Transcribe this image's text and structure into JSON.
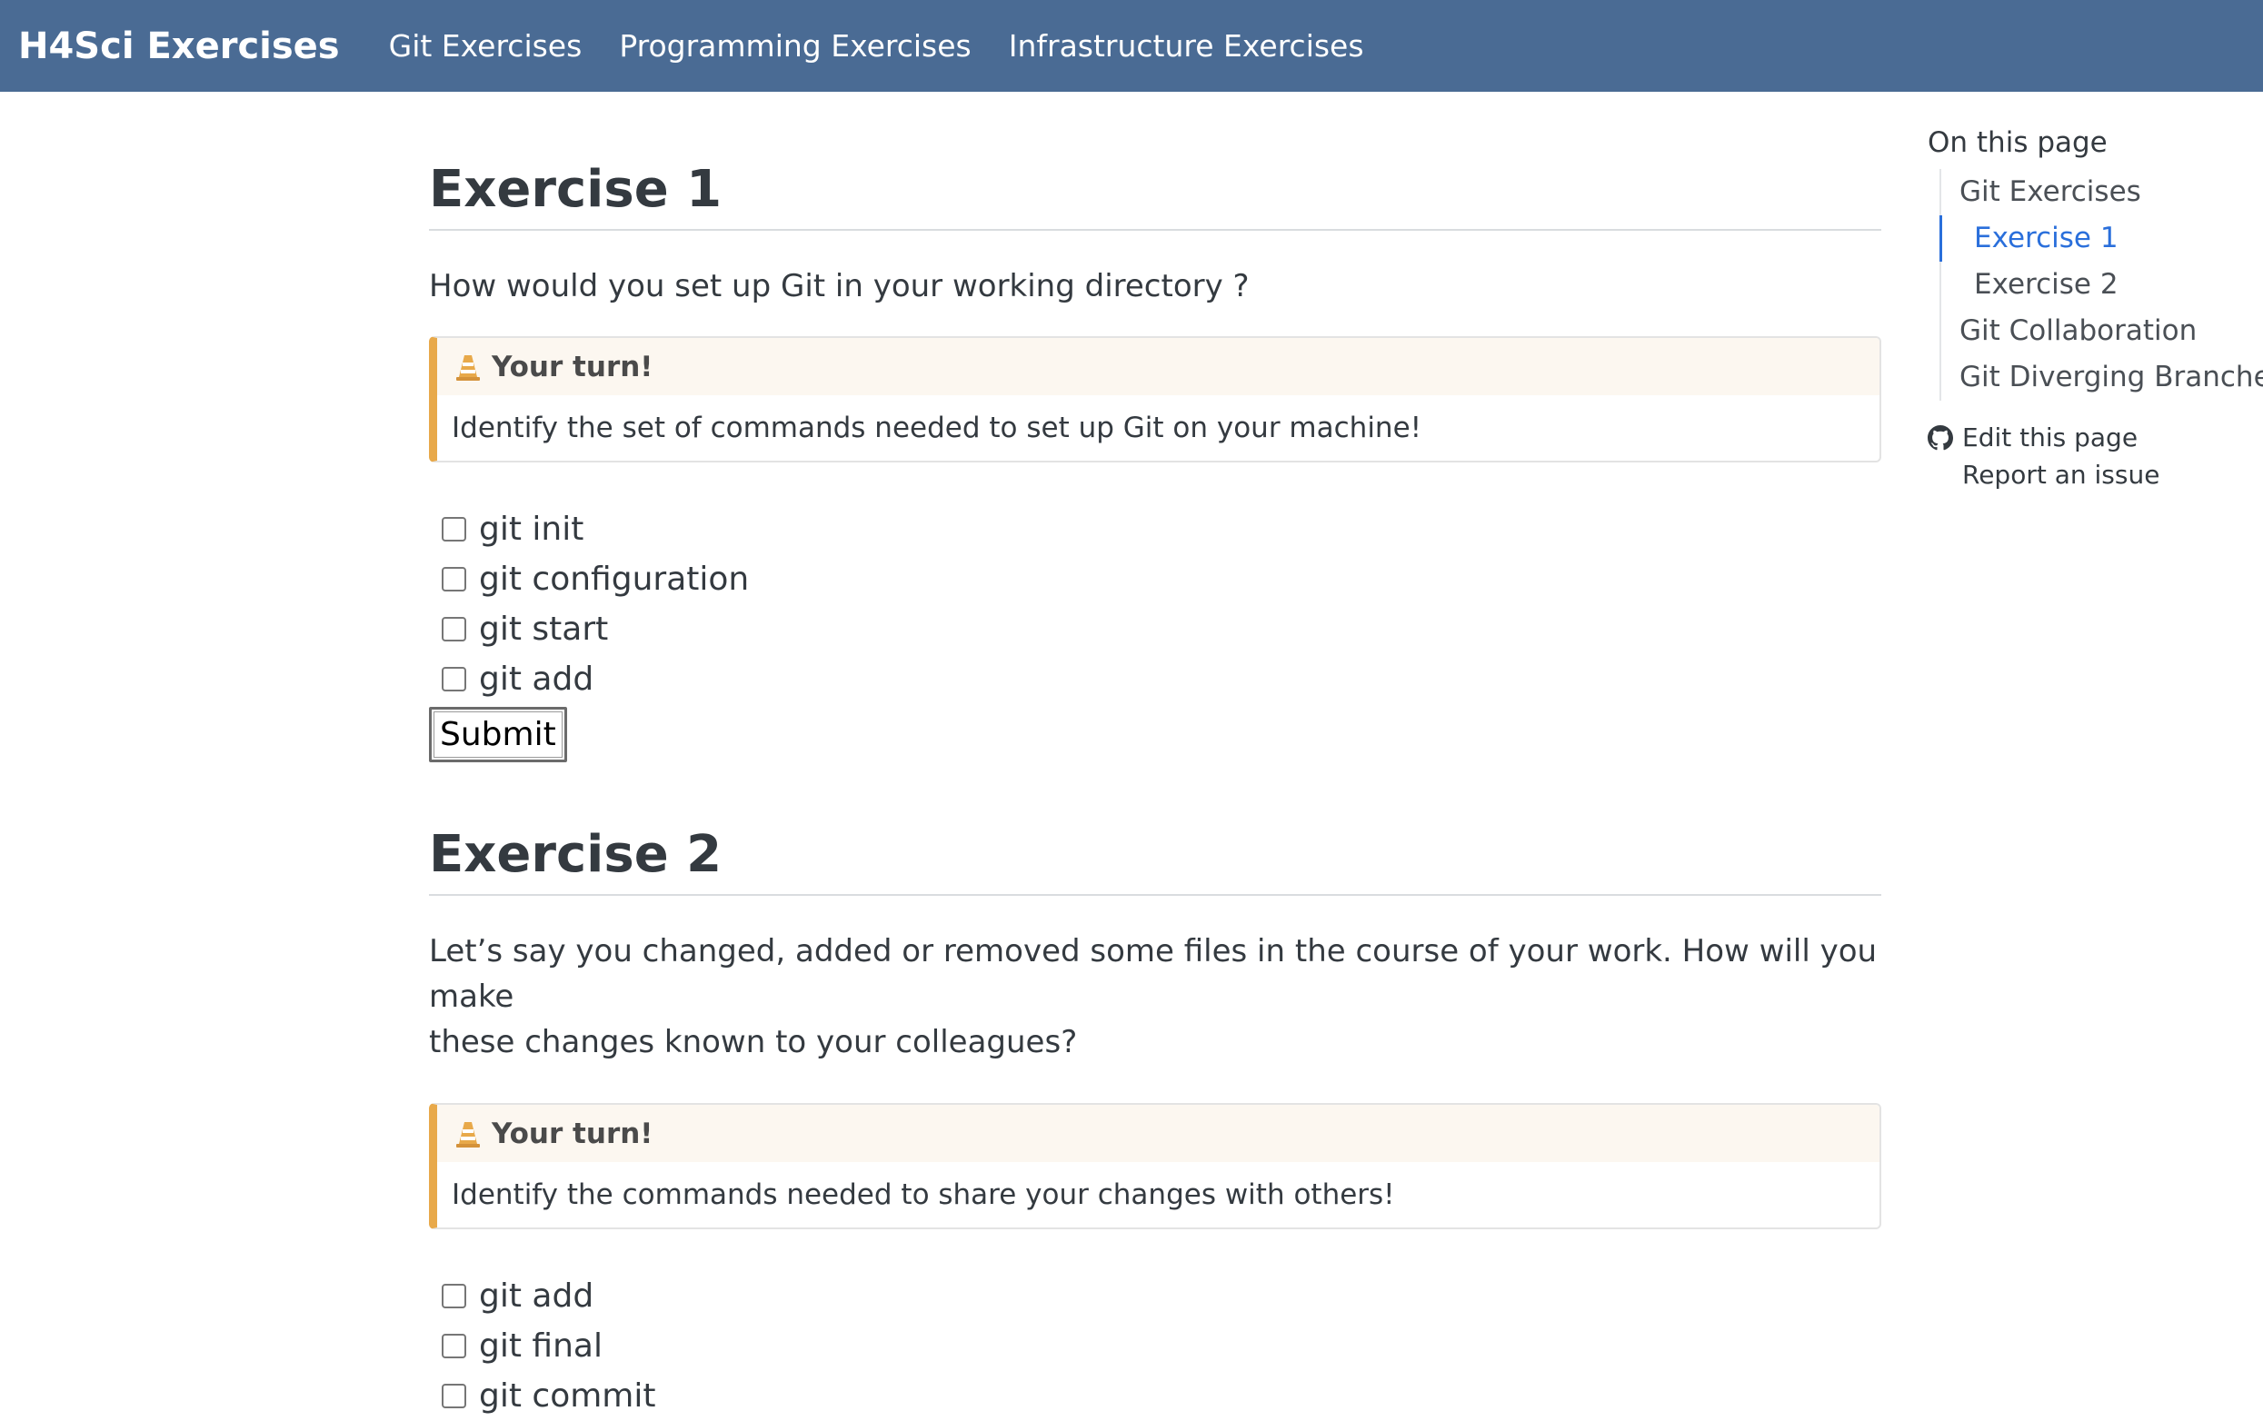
{
  "navbar": {
    "brand": "H4Sci Exercises",
    "links": [
      {
        "label": "Git Exercises"
      },
      {
        "label": "Programming Exercises"
      },
      {
        "label": "Infrastructure Exercises"
      }
    ],
    "background_color": "#4a6b94"
  },
  "exercises": [
    {
      "title": "Exercise 1",
      "question": "How would you set up Git in your working directory ?",
      "callout": {
        "icon": "traffic-cone-icon",
        "header": "Your turn!",
        "body": "Identify the set of commands needed to set up Git on your machine!"
      },
      "options": [
        {
          "label": "git init",
          "checked": false
        },
        {
          "label": "git configuration",
          "checked": false
        },
        {
          "label": "git start",
          "checked": false
        },
        {
          "label": "git add",
          "checked": false
        }
      ],
      "submit_label": "Submit"
    },
    {
      "title": "Exercise 2",
      "question_line1": "Let’s say you changed, added or removed some files in the course of your work. How will you make",
      "question_line2": "these changes known to your colleagues?",
      "callout": {
        "icon": "traffic-cone-icon",
        "header": "Your turn!",
        "body": "Identify the commands needed to share your changes with others!"
      },
      "options": [
        {
          "label": "git add",
          "checked": false
        },
        {
          "label": "git final",
          "checked": false
        },
        {
          "label": "git commit",
          "checked": false
        }
      ]
    }
  ],
  "toc": {
    "title": "On this page",
    "items": [
      {
        "label": "Git Exercises",
        "level": 1,
        "active": false
      },
      {
        "label": "Exercise 1",
        "level": 2,
        "active": true
      },
      {
        "label": "Exercise 2",
        "level": 2,
        "active": false
      },
      {
        "label": "Git Collaboration",
        "level": 1,
        "active": false
      },
      {
        "label": "Git Diverging Branches",
        "level": 1,
        "active": false
      }
    ],
    "edit_link": {
      "icon": "github-icon",
      "label": "Edit this page"
    },
    "issue_link": {
      "label": "Report an issue"
    }
  },
  "colors": {
    "accent": "#2a6fdb",
    "callout_border": "#e8a94a",
    "callout_header_bg": "#fcf7f0"
  }
}
